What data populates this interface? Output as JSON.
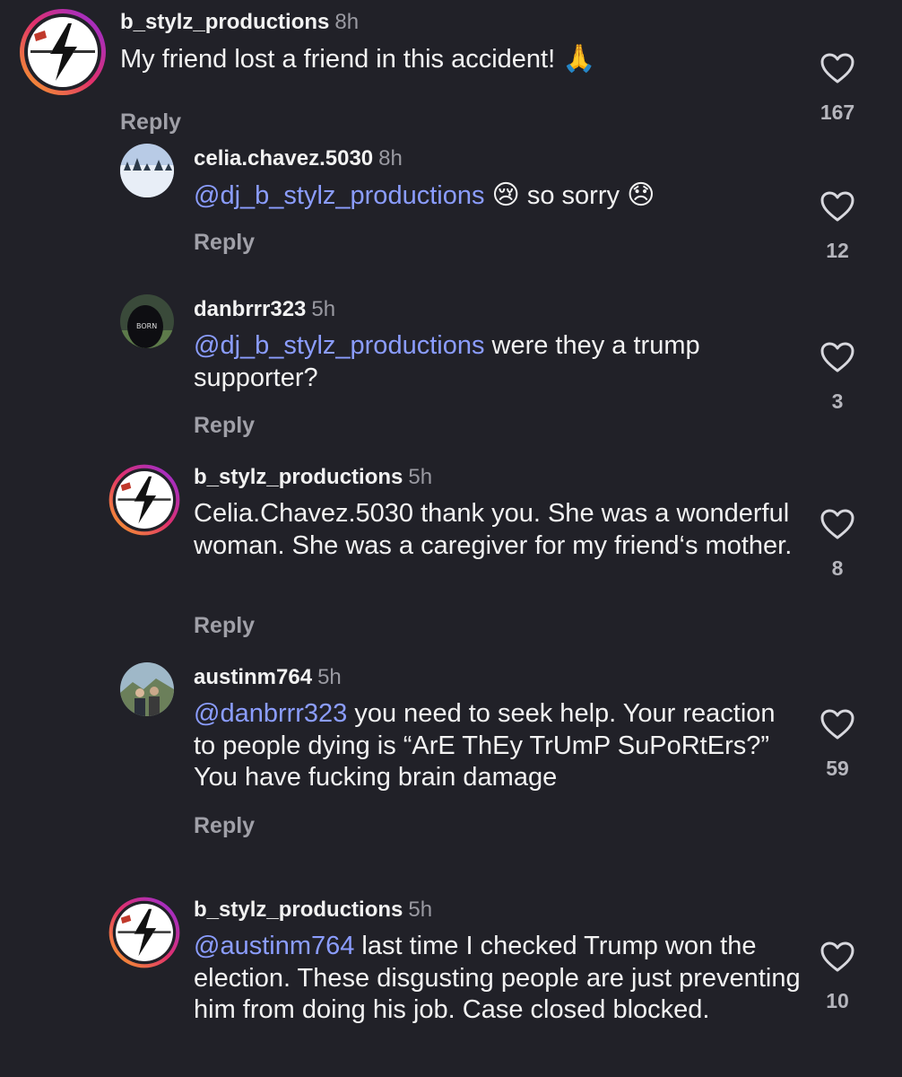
{
  "comments": [
    {
      "username": "b_stylz_productions",
      "time": "8h",
      "mention": "",
      "text": "My friend lost a friend in this accident!",
      "emoji1": "🙏",
      "emoji_text": "",
      "emoji2": "",
      "reply_label": "Reply",
      "likes": "167",
      "avatar": "lightning-logo-avatar"
    },
    {
      "username": "celia.chavez.5030",
      "time": "8h",
      "mention": "@dj_b_stylz_productions",
      "text": "",
      "emoji1": "😢",
      "emoji_text": "so sorry",
      "emoji2": "😞",
      "reply_label": "Reply",
      "likes": "12",
      "avatar": "snowy-landscape-avatar"
    },
    {
      "username": "danbrrr323",
      "time": "5h",
      "mention": "@dj_b_stylz_productions",
      "text": " were they a trump supporter?",
      "reply_label": "Reply",
      "likes": "3",
      "avatar": "hooded-person-avatar"
    },
    {
      "username": "b_stylz_productions",
      "time": "5h",
      "mention": "",
      "text": "Celia.Chavez.5030 thank you. She was a wonderful woman. She was a caregiver for my friend‘s mother.",
      "reply_label": "Reply",
      "likes": "8",
      "avatar": "lightning-logo-avatar"
    },
    {
      "username": "austinm764",
      "time": "5h",
      "mention": "@danbrrr323",
      "text": " you need to seek help. Your reaction to people dying is “ArE ThEy TrUmP SuPoRtErs?” You have fucking brain damage",
      "reply_label": "Reply",
      "likes": "59",
      "avatar": "two-people-outdoors-avatar"
    },
    {
      "username": "b_stylz_productions",
      "time": "5h",
      "mention": "@austinm764",
      "text": " last time I checked Trump won the election. These disgusting people are just preventing him from doing his job. Case closed blocked.",
      "likes": "10",
      "avatar": "lightning-logo-avatar"
    }
  ],
  "icons": {
    "like": "heart-outline-icon"
  },
  "colors": {
    "background": "#212128",
    "mention": "#8b9dff",
    "ring_start": "#f9a825",
    "ring_mid": "#e1306c",
    "ring_end": "#8e2de2"
  }
}
